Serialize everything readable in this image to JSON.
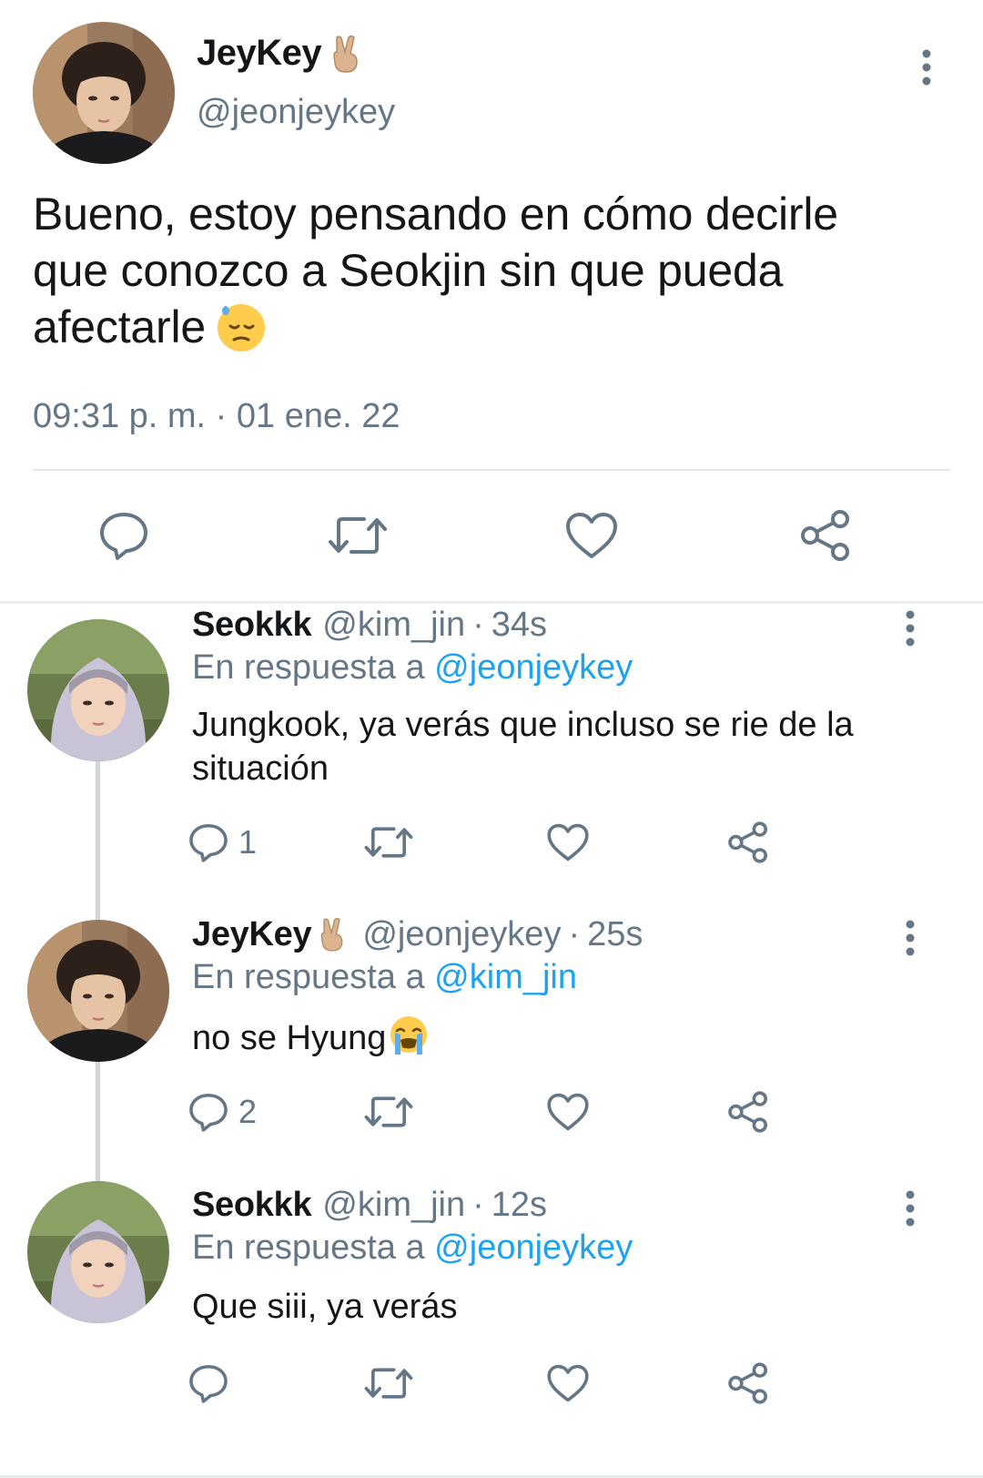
{
  "colors": {
    "text": "#14171a",
    "secondary": "#657786",
    "link": "#1da1f2",
    "divider": "#e1e8ed"
  },
  "main_tweet": {
    "name": "JeyKey",
    "name_emoji": "victory-hand",
    "handle": "@jeonjeykey",
    "text_line_1": "Bueno, estoy pensando en cómo decirle",
    "text_line_2": "que conozco a Seokjin sin que pueda",
    "text_line_3": "afectarle",
    "text_emoji": "downcast-face-with-sweat",
    "timestamp": "09:31 p. m. · 01 ene. 22",
    "actions": [
      "reply-icon",
      "retweet-icon",
      "like-icon",
      "share-icon"
    ]
  },
  "replies": [
    {
      "name": "Seokkk",
      "handle": "@kim_jin",
      "sep": "·",
      "time": "34s",
      "reply_to_label": "En respuesta a",
      "reply_to_mention": "@jeonjeykey",
      "text_line_1": "Jungkook, ya verás que incluso se rie de la",
      "text_line_2": "situación",
      "reply_count": "1"
    },
    {
      "name": "JeyKey",
      "name_emoji": "victory-hand",
      "handle": "@jeonjeykey",
      "sep": "·",
      "time": "25s",
      "reply_to_label": "En respuesta a",
      "reply_to_mention": "@kim_jin",
      "text": "no se Hyung",
      "text_emoji": "loudly-crying-face",
      "reply_count": "2"
    },
    {
      "name": "Seokkk",
      "handle": "@kim_jin",
      "sep": "·",
      "time": "12s",
      "reply_to_label": "En respuesta a",
      "reply_to_mention": "@jeonjeykey",
      "text": "Que siii, ya verás",
      "reply_count": ""
    }
  ]
}
